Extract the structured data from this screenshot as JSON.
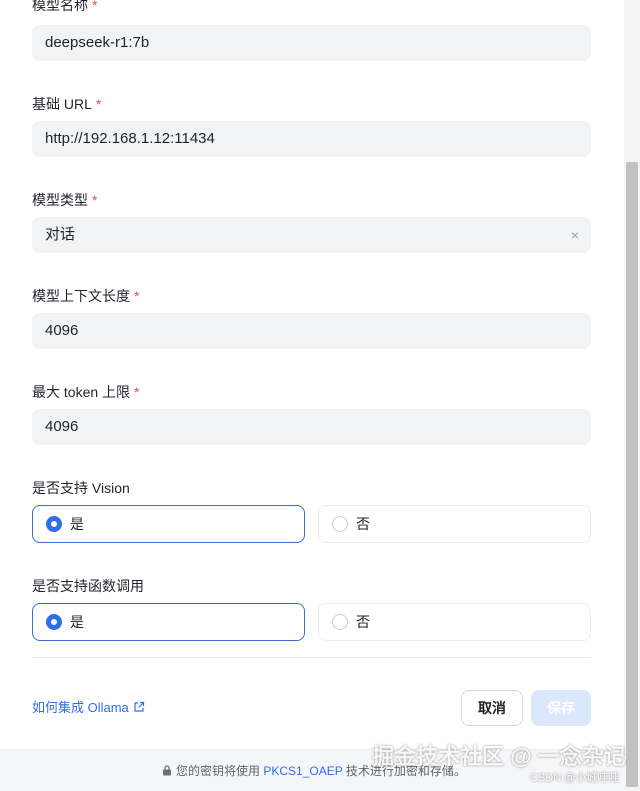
{
  "form": {
    "model_name": {
      "label": "模型名称",
      "required": "*",
      "value": "deepseek-r1:7b"
    },
    "base_url": {
      "label": "基础 URL",
      "required": "*",
      "value": "http://192.168.1.12:11434"
    },
    "model_type": {
      "label": "模型类型",
      "required": "*",
      "value": "对话",
      "clear": "×"
    },
    "context_length": {
      "label": "模型上下文长度",
      "required": "*",
      "value": "4096"
    },
    "max_tokens": {
      "label": "最大 token 上限",
      "required": "*",
      "value": "4096"
    },
    "vision": {
      "label": "是否支持 Vision",
      "options": [
        "是",
        "否"
      ],
      "selected": "是"
    },
    "function_call": {
      "label": "是否支持函数调用",
      "options": [
        "是",
        "否"
      ],
      "selected": "是"
    }
  },
  "actions": {
    "help_link": "如何集成 Ollama",
    "cancel": "取消",
    "save": "保存"
  },
  "footer": {
    "prefix": "您的密钥将使用",
    "algorithm": "PKCS1_OAEP",
    "suffix": "技术进行加密和存储。"
  },
  "watermark": {
    "main": "掘金技术社区 @ 一念杂记",
    "sub": "CSDN @小城哇哇"
  },
  "colors": {
    "accent": "#2f6ee6",
    "required": "#e5484d",
    "input_bg": "#f1f3f5"
  }
}
